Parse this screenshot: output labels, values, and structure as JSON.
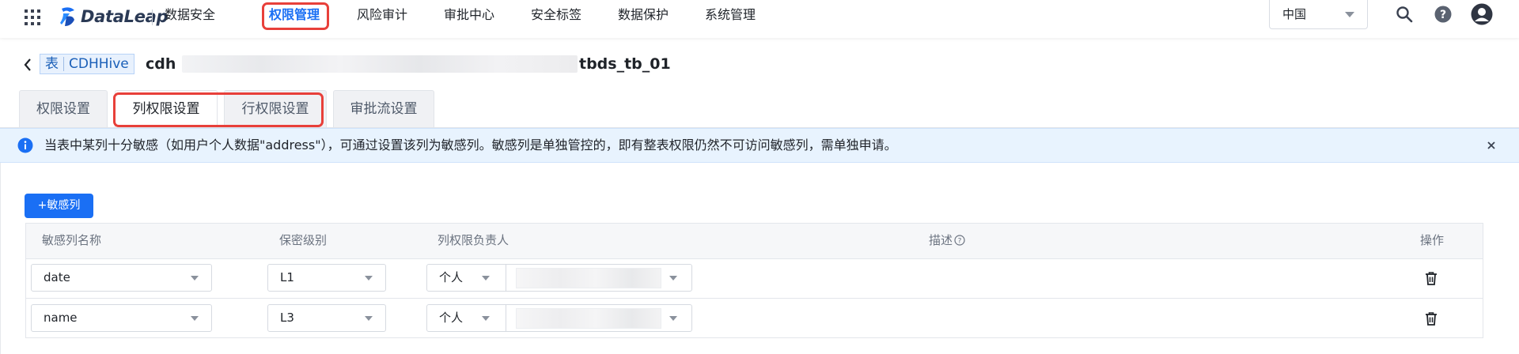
{
  "topnav": {
    "logo_text": "DataLeap",
    "product": "数据安全",
    "items": [
      {
        "label": "权限管理",
        "active": true
      },
      {
        "label": "风险审计"
      },
      {
        "label": "审批中心"
      },
      {
        "label": "安全标签"
      },
      {
        "label": "数据保护"
      },
      {
        "label": "系统管理"
      }
    ],
    "region": "中国",
    "icons": [
      "apps-grid-icon",
      "search-icon",
      "help-icon",
      "user-avatar-icon"
    ]
  },
  "breadcrumb": {
    "type_char": "表",
    "type_label": "CDHHive",
    "name_prefix": "cdh",
    "name_suffix": "tbds_tb_01"
  },
  "tabs": [
    {
      "label": "权限设置"
    },
    {
      "label": "列权限设置",
      "active": true
    },
    {
      "label": "行权限设置"
    },
    {
      "label": "审批流设置"
    }
  ],
  "banner": {
    "text": "当表中某列十分敏感（如用户个人数据\"address\"），可通过设置该列为敏感列。敏感列是单独管控的，即有整表权限仍然不可访问敏感列，需单独申请。"
  },
  "add_button": "+敏感列",
  "table": {
    "headers": {
      "column": "敏感列名称",
      "level": "保密级别",
      "owner": "列权限负责人",
      "description": "描述",
      "actions": "操作"
    },
    "rows": [
      {
        "column": "date",
        "level": "L1",
        "owner_type": "个人"
      },
      {
        "column": "name",
        "level": "L3",
        "owner_type": "个人"
      }
    ]
  },
  "colors": {
    "primary": "#1a6ff4",
    "highlight_box": "#e8403a",
    "banner_bg": "#e8f3fe"
  }
}
